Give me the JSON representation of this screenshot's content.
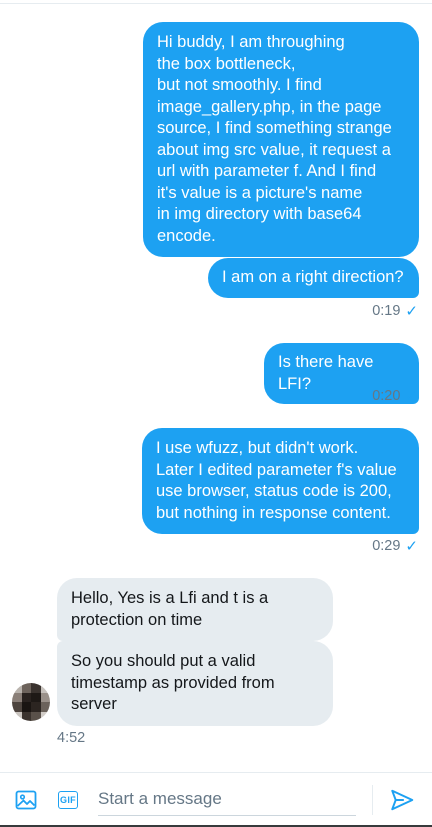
{
  "colors": {
    "accent": "#1da1f2",
    "incoming_bubble": "#e6ecf0",
    "meta_text": "#657786"
  },
  "messages": {
    "m1": "Hi buddy, I am throughing\nthe box bottleneck,\nbut not smoothly. I find\nimage_gallery.php, in the page\nsource, I find something strange\nabout img src value, it request a\nurl with parameter f. And I find\nit's value is a picture's name\nin img directory with base64\nencode.",
    "m2": "I am on a right direction?",
    "t2": "0:19",
    "m3": "Is there have LFI?",
    "t3": "0:20",
    "m4": "I use wfuzz, but didn't work.\nLater I edited parameter f's value\nuse browser, status code is 200,\nbut nothing in response content.",
    "t4": "0:29",
    "r1": "Hello, Yes is a Lfi and t is a\nprotection on time",
    "r2": "So you should put a valid\ntimestamp as provided from\nserver",
    "tr": "4:52"
  },
  "composer": {
    "placeholder": "Start a message",
    "gif_label": "GIF",
    "image_icon": "image-icon",
    "send_icon": "send-icon"
  }
}
